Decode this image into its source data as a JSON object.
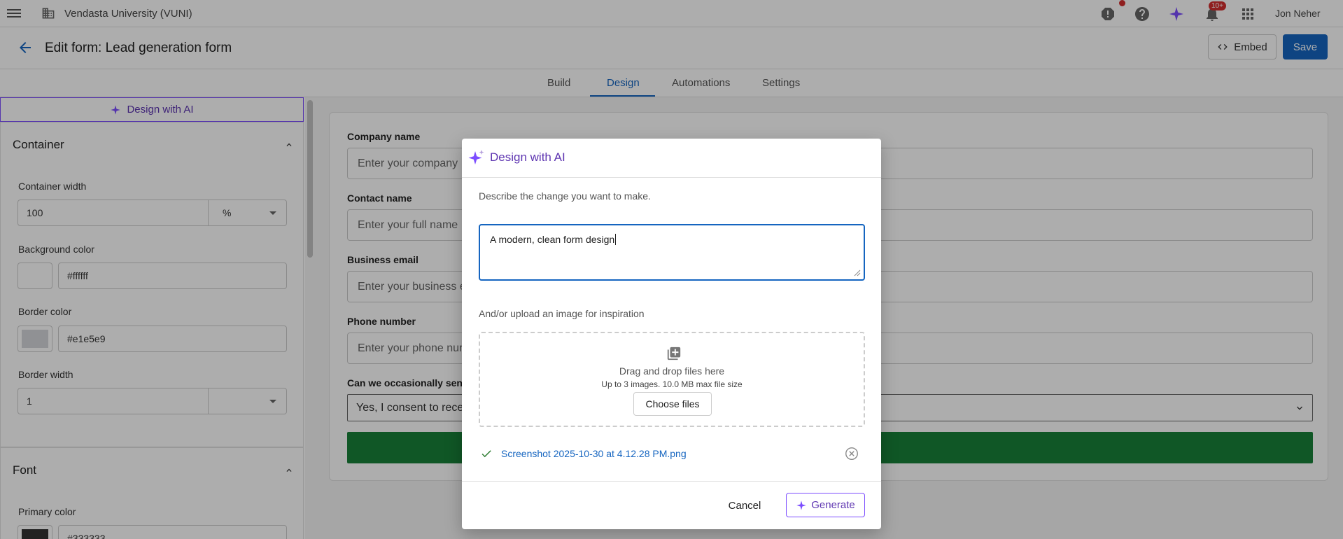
{
  "topbar": {
    "org_name": "Vendasta University (VUNI)",
    "user_name": "Jon Neher",
    "notification_badge": "10+"
  },
  "header": {
    "title": "Edit form: Lead generation form",
    "embed_label": "Embed",
    "save_label": "Save"
  },
  "tabs": [
    {
      "label": "Build",
      "active": false
    },
    {
      "label": "Design",
      "active": true
    },
    {
      "label": "Automations",
      "active": false
    },
    {
      "label": "Settings",
      "active": false
    }
  ],
  "left_panel": {
    "ai_button_label": "Design with AI",
    "container": {
      "title": "Container",
      "width_label": "Container width",
      "width_value": "100",
      "width_unit": "%",
      "bg_label": "Background color",
      "bg_value": "#ffffff",
      "border_color_label": "Border color",
      "border_color_value": "#e1e5e9",
      "border_width_label": "Border width",
      "border_width_value": "1"
    },
    "font": {
      "title": "Font",
      "primary_color_label": "Primary color",
      "primary_color_value": "#333333"
    }
  },
  "preview": {
    "fields": [
      {
        "label": "Company name",
        "placeholder": "Enter your company"
      },
      {
        "label": "Contact name",
        "placeholder": "Enter your full name"
      },
      {
        "label": "Business email",
        "placeholder": "Enter your business e"
      },
      {
        "label": "Phone number",
        "placeholder": "Enter your phone nur"
      }
    ],
    "consent_label": "Can we occasionally sen",
    "consent_value": "Yes, I consent to rece",
    "submit_color": "#188038"
  },
  "modal": {
    "title": "Design with AI",
    "prompt_label": "Describe the change you want to make.",
    "textarea_value": "A modern, clean form design",
    "upload_label": "And/or upload an image for inspiration",
    "dropzone_main": "Drag and drop files here",
    "dropzone_sub": "Up to 3 images. 10.0 MB max file size",
    "choose_files_label": "Choose files",
    "file_name": "Screenshot 2025-10-30 at 4.12.28 PM.png",
    "cancel_label": "Cancel",
    "generate_label": "Generate"
  },
  "colors": {
    "accent": "#1565c0",
    "ai_purple": "#7c4dff",
    "success_green": "#2e7d32"
  }
}
